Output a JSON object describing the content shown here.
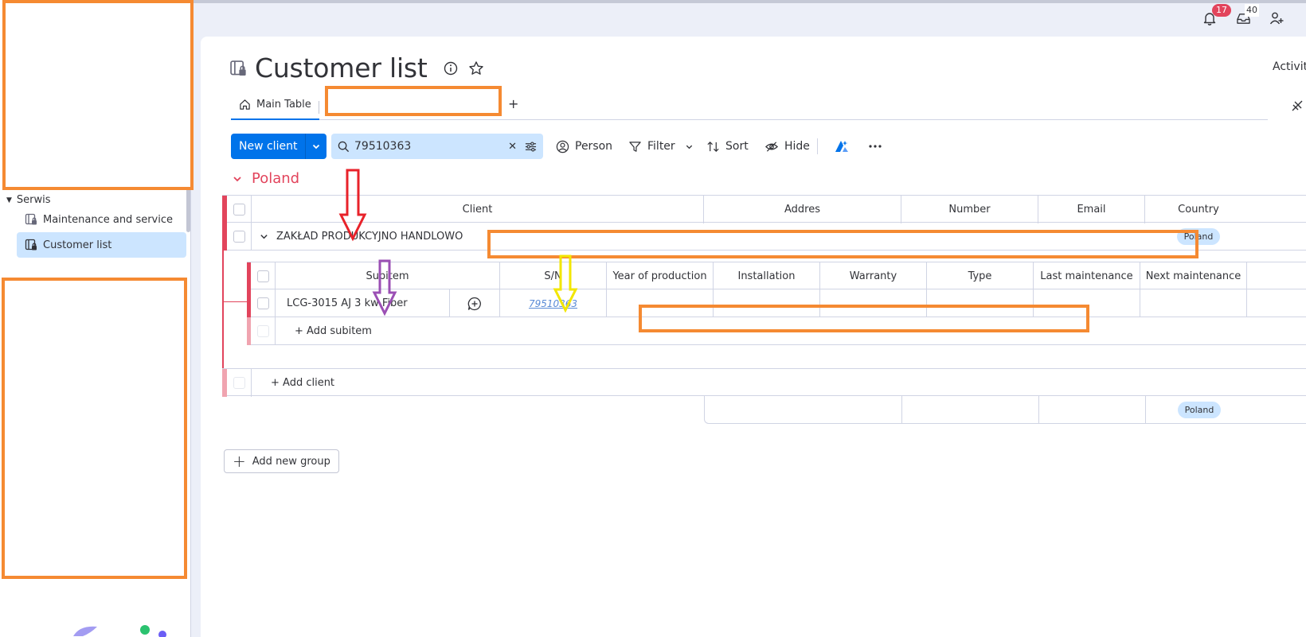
{
  "sidebar": {
    "folder": "Serwis",
    "items": [
      {
        "label": "Maintenance and service",
        "active": false
      },
      {
        "label": "Customer list",
        "active": true
      }
    ]
  },
  "topbar": {
    "notifications_count": "17",
    "inbox_count": "40"
  },
  "page": {
    "title": "Customer list",
    "activity_label": "Activit"
  },
  "tabs": {
    "main_label": "Main Table",
    "add_label": "+"
  },
  "toolbar": {
    "new_label": "New client",
    "search_value": "79510363",
    "person_label": "Person",
    "filter_label": "Filter",
    "sort_label": "Sort",
    "hide_label": "Hide"
  },
  "group": {
    "title": "Poland",
    "columns": [
      "Client",
      "Addres",
      "Number",
      "Email",
      "Country"
    ],
    "item": {
      "client": "ZAKŁAD PRODUKCYJNO HANDLOWO",
      "country": "Poland"
    },
    "add_item_label": "+ Add client",
    "footer_country": "Poland"
  },
  "subitems": {
    "columns": [
      "Subitem",
      "S/N",
      "Year of production",
      "Installation",
      "Warranty",
      "Type",
      "Last maintenance",
      "Next maintenance"
    ],
    "row": {
      "name": "LCG-3015 AJ 3 kw Fiber",
      "sn": "79510363"
    },
    "add_label": "+ Add subitem"
  },
  "add_group_label": "Add new group",
  "colors": {
    "accent": "#0073ea",
    "group": "#e2445c",
    "redaction": "#f58a32",
    "arrow_red": "#e8222a",
    "arrow_purple": "#9b4fb4",
    "arrow_yellow": "#f2e600"
  }
}
